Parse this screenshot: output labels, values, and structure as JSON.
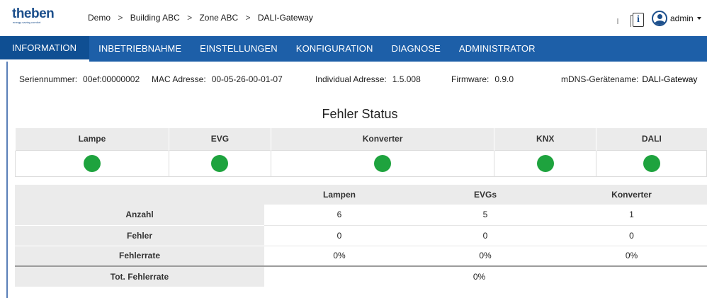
{
  "header": {
    "logo": "theben",
    "logo_tagline": "energy saving comfort",
    "breadcrumb": [
      "Demo",
      "Building ABC",
      "Zone ABC",
      "DALI-Gateway"
    ],
    "separator": ">",
    "info_icon_glyph": "i",
    "user": "admin"
  },
  "nav": {
    "items": [
      "INFORMATION",
      "INBETRIEBNAHME",
      "EINSTELLUNGEN",
      "KONFIGURATION",
      "DIAGNOSE",
      "ADMINISTRATOR"
    ],
    "active_index": 0
  },
  "device_info": {
    "serial_label": "Seriennummer:",
    "serial_value": "00ef:00000002",
    "mac_label": "MAC Adresse:",
    "mac_value": "00-05-26-00-01-07",
    "individual_label": "Individual Adresse:",
    "individual_value": "1.5.008",
    "firmware_label": "Firmware:",
    "firmware_value": "0.9.0",
    "mdns_label": "mDNS-Gerätename:",
    "mdns_value": "DALI-Gateway"
  },
  "fehler_status": {
    "title": "Fehler Status",
    "columns": [
      "Lampe",
      "EVG",
      "Konverter",
      "KNX",
      "DALI"
    ],
    "states": [
      "ok",
      "ok",
      "ok",
      "ok",
      "ok"
    ]
  },
  "stats": {
    "headers": [
      "",
      "Lampen",
      "EVGs",
      "Konverter"
    ],
    "rows": [
      {
        "label": "Anzahl",
        "values": [
          "6",
          "5",
          "1"
        ]
      },
      {
        "label": "Fehler",
        "values": [
          "0",
          "0",
          "0"
        ]
      },
      {
        "label": "Fehlerrate",
        "values": [
          "0%",
          "0%",
          "0%"
        ]
      }
    ],
    "total_label": "Tot. Fehlerrate",
    "total_value": "0%"
  },
  "colors": {
    "nav_bg": "#1d5fa8",
    "nav_active_bg": "#0f4f93",
    "status_ok": "#1ea33e",
    "brand": "#1c4f8c"
  }
}
